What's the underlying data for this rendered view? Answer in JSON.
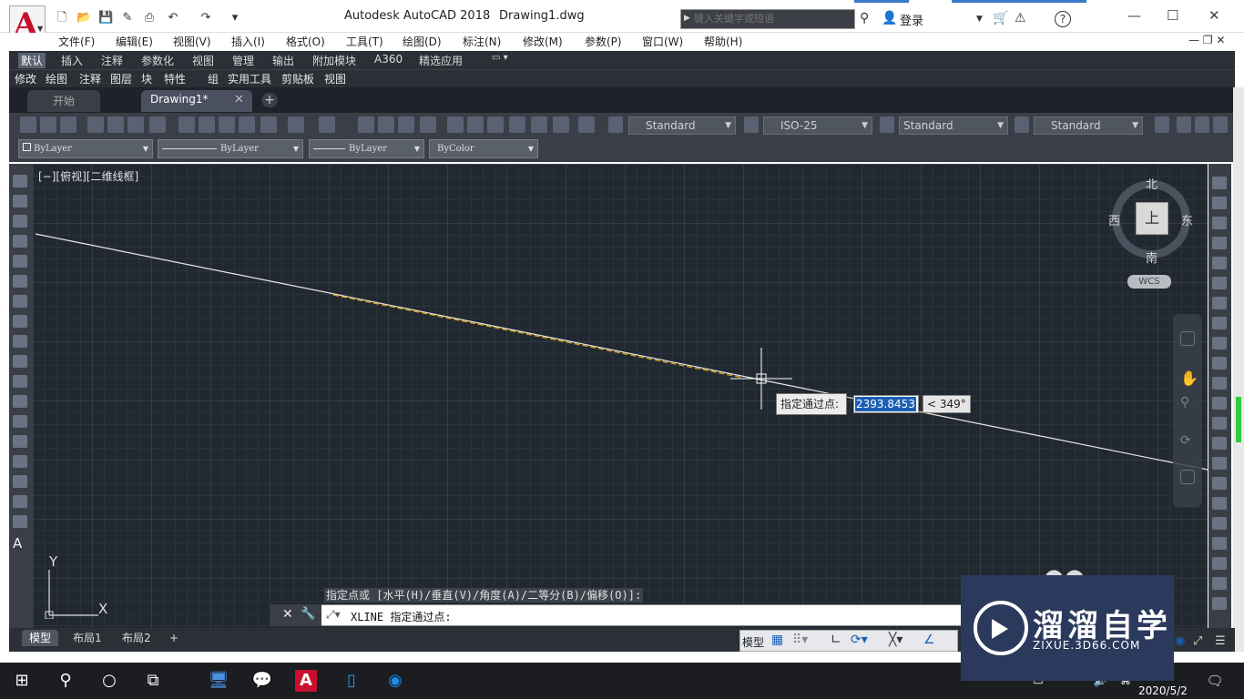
{
  "title_bar": {
    "app_title": "Autodesk AutoCAD 2018",
    "document": "Drawing1.dwg",
    "search_placeholder": "键入关键字或短语",
    "login": "登录"
  },
  "menu_bar": [
    "文件(F)",
    "编辑(E)",
    "视图(V)",
    "插入(I)",
    "格式(O)",
    "工具(T)",
    "绘图(D)",
    "标注(N)",
    "修改(M)",
    "参数(P)",
    "窗口(W)",
    "帮助(H)"
  ],
  "ribbon_tabs": [
    "默认",
    "插入",
    "注释",
    "参数化",
    "视图",
    "管理",
    "输出",
    "附加模块",
    "A360",
    "精选应用"
  ],
  "ribbon_panels": [
    "修改",
    "绘图",
    "注释",
    "图层",
    "块",
    "特性",
    "组",
    "实用工具",
    "剪贴板",
    "视图"
  ],
  "file_tabs": {
    "start": "开始",
    "drawing": "Drawing1*"
  },
  "styles_toolbar": {
    "text_style": "Standard",
    "dim_style": "ISO-25",
    "table_style": "Standard",
    "mleader_style": "Standard"
  },
  "properties_toolbar": {
    "layer": "ByLayer",
    "linetype": "ByLayer",
    "lineweight": "ByLayer",
    "color": "ByColor"
  },
  "viewport": {
    "label": "[−][俯视][二维线框]",
    "viewcube": {
      "top": "上",
      "north": "北",
      "south": "南",
      "east": "东",
      "west": "西",
      "wcs": "WCS"
    },
    "tooltip": "指定通过点:",
    "distance": "2393.8453",
    "angle": "< 349°",
    "ucs_x": "X",
    "ucs_y": "Y"
  },
  "command": {
    "history": "指定点或 [水平(H)/垂直(V)/角度(A)/二等分(B)/偏移(O)]:",
    "current": "XLINE 指定通过点:"
  },
  "layout_tabs": [
    "模型",
    "布局1",
    "布局2"
  ],
  "status": {
    "model": "模型"
  },
  "watermark": {
    "name": "溜溜自学",
    "url": "ZIXUE.3D66.COM"
  },
  "taskbar": {
    "date": "2020/5/2"
  },
  "colors": {
    "accent": "#c8102e",
    "canvas": "#212830",
    "selection": "#1a5fb4",
    "xline_highlight": "#d4a017"
  }
}
